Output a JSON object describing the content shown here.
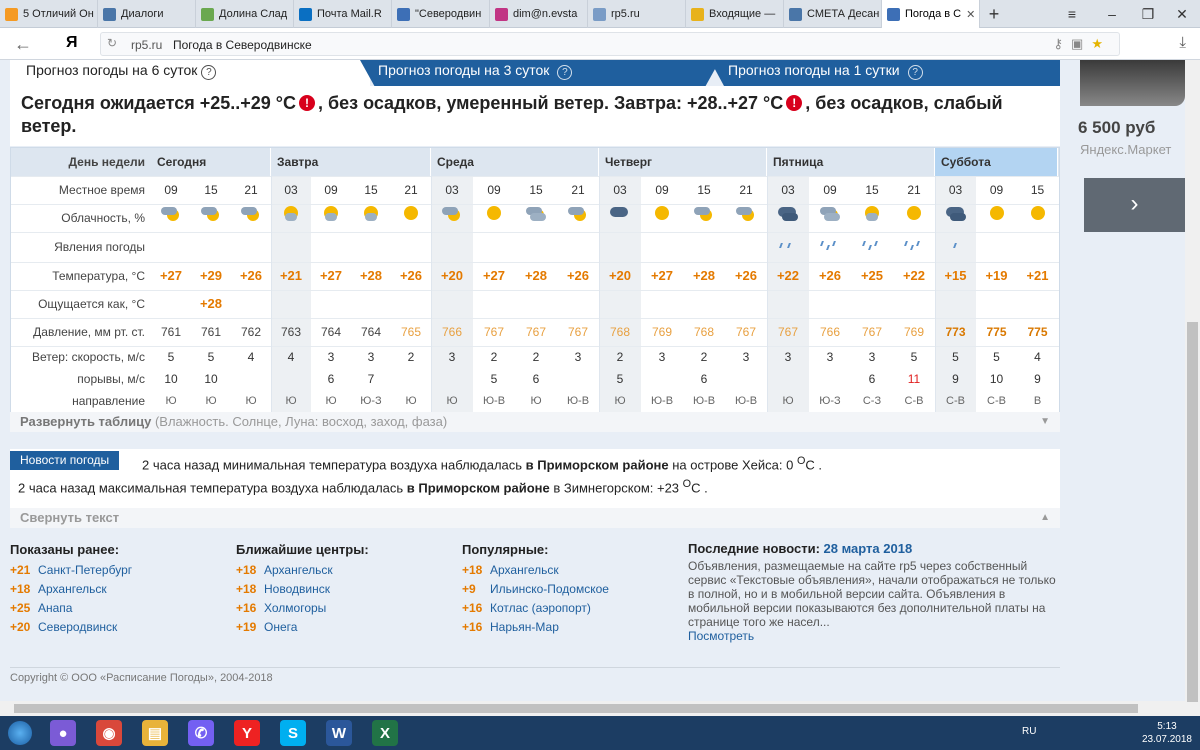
{
  "browser": {
    "tabs": [
      {
        "label": "5 Отличий Он",
        "color": "#f59a23"
      },
      {
        "label": "Диалоги",
        "color": "#4a76a8"
      },
      {
        "label": "Долина Слад",
        "color": "#6aa84f"
      },
      {
        "label": "Почта Mail.R",
        "color": "#0a6fc2"
      },
      {
        "label": "\"Северодвин",
        "color": "#3d6fb6"
      },
      {
        "label": "dim@n.evsta",
        "color": "#c13584"
      },
      {
        "label": "rp5.ru",
        "color": "#7a9cc6"
      },
      {
        "label": "Входящие —",
        "color": "#e8b21b"
      },
      {
        "label": "СМЕТА Десан",
        "color": "#4a76a8"
      },
      {
        "label": "Погода в С",
        "color": "#3d6fb6"
      }
    ],
    "address_domain": "rp5.ru",
    "address_title": "Погода в Северодвинске",
    "yandex_logo": "Я"
  },
  "page": {
    "period_tabs": [
      {
        "label": "Прогноз погоды на 6 суток",
        "help": "?"
      },
      {
        "label": "Прогноз погоды на 3 суток",
        "help": "?"
      },
      {
        "label": "Прогноз погоды на 1 сутки",
        "help": "?"
      }
    ],
    "summary": {
      "part1": "Сегодня ожидается +25..+29 °C",
      "part2": ", без осадков, умеренный ветер. Завтра: +28..+27 °C",
      "part3": ", без осадков, слабый ветер.",
      "warn_icon": "!"
    },
    "table": {
      "labels": {
        "day": "День недели",
        "time": "Местное время",
        "cloud": "Облачность, %",
        "phenom": "Явления погоды",
        "temp": "Температура, °C",
        "feels": "Ощущается как, °C",
        "pressure": "Давление, мм рт. ст.",
        "wind": "Ветер: скорость, м/с",
        "gusts": "порывы, м/с",
        "direction": "направление"
      },
      "days": [
        "Сегодня",
        "Завтра",
        "Среда",
        "Четверг",
        "Пятница",
        "Суббота"
      ],
      "times": [
        "09",
        "15",
        "21",
        "03",
        "09",
        "15",
        "21",
        "03",
        "09",
        "15",
        "21",
        "03",
        "09",
        "15",
        "21",
        "03",
        "09",
        "15",
        "21",
        "03",
        "09",
        "15"
      ],
      "temps": [
        "+27",
        "+29",
        "+26",
        "+21",
        "+27",
        "+28",
        "+26",
        "+20",
        "+27",
        "+28",
        "+26",
        "+20",
        "+27",
        "+28",
        "+26",
        "+22",
        "+26",
        "+25",
        "+22",
        "+15",
        "+19",
        "+21"
      ],
      "feels": [
        "",
        "+28",
        "",
        "",
        "",
        "",
        "",
        "",
        "",
        "",
        "",
        "",
        "",
        "",
        "",
        "",
        "",
        "",
        "",
        "",
        "",
        ""
      ],
      "pressure": [
        "761",
        "761",
        "762",
        "763",
        "764",
        "764",
        "765",
        "766",
        "767",
        "767",
        "767",
        "768",
        "769",
        "768",
        "767",
        "767",
        "766",
        "767",
        "769",
        "773",
        "775",
        "775"
      ],
      "wind": [
        "5",
        "5",
        "4",
        "4",
        "3",
        "3",
        "2",
        "3",
        "2",
        "2",
        "3",
        "2",
        "3",
        "2",
        "3",
        "3",
        "3",
        "3",
        "5",
        "5",
        "5",
        "4"
      ],
      "gusts": [
        "10",
        "10",
        "",
        "",
        "6",
        "7",
        "",
        "",
        "5",
        "6",
        "",
        "5",
        "",
        "6",
        "",
        "",
        "",
        "6",
        "11",
        "9",
        "10",
        "9"
      ],
      "direction": [
        "Ю",
        "Ю",
        "Ю",
        "Ю",
        "Ю",
        "Ю-З",
        "Ю",
        "Ю",
        "Ю-В",
        "Ю",
        "Ю-В",
        "Ю",
        "Ю-В",
        "Ю-В",
        "Ю-В",
        "Ю",
        "Ю-З",
        "С-З",
        "С-В",
        "С-В",
        "С-В",
        "В"
      ]
    },
    "expand_label": "Развернуть таблицу",
    "expand_hint": "(Влажность. Солнце, Луна: восход, заход, фаза)",
    "news": {
      "header": "Новости погоды",
      "line1_pre": "2 часа назад минимальная температура воздуха наблюдалась ",
      "line1_bold": "в Приморском районе",
      "line1_post": " на острове Хейса: 0 ",
      "line1_unit": "C",
      "line1_deg": "O",
      "line2_pre": "2 часа назад максимальная температура воздуха наблюдалась ",
      "line2_bold": "в Приморском районе",
      "line2_post": " в Зимнегорском: +23 ",
      "line2_deg": "O",
      "line2_unit": "C",
      "collapse": "Свернуть текст"
    },
    "shown_before": {
      "title": "Показаны ранее:",
      "items": [
        {
          "temp": "+21",
          "city": "Санкт-Петербург"
        },
        {
          "temp": "+18",
          "city": "Архангельск"
        },
        {
          "temp": "+25",
          "city": "Анапа"
        },
        {
          "temp": "+20",
          "city": "Северодвинск"
        }
      ]
    },
    "nearest": {
      "title": "Ближайшие центры:",
      "items": [
        {
          "temp": "+18",
          "city": "Архангельск"
        },
        {
          "temp": "+18",
          "city": "Новодвинск"
        },
        {
          "temp": "+16",
          "city": "Холмогоры"
        },
        {
          "temp": "+19",
          "city": "Онега"
        }
      ]
    },
    "popular": {
      "title": "Популярные:",
      "items": [
        {
          "temp": "+18",
          "city": "Архангельск"
        },
        {
          "temp": "+9",
          "city": "Ильинско-Подомское"
        },
        {
          "temp": "+16",
          "city": "Котлас (аэропорт)"
        },
        {
          "temp": "+16",
          "city": "Нарьян-Мар"
        }
      ]
    },
    "last_news": {
      "title": "Последние новости:",
      "date": "28 марта 2018",
      "text": "Объявления, размещаемые на сайте rp5 через собственный сервис «Текстовые объявления», начали отображаться не только в полной, но и в мобильной версии сайта. Объявления в мобильной версии показываются без дополнительной платы на странице того же насел...",
      "link": "Посмотреть"
    },
    "copyright": "Copyright © ООО «Расписание Погоды», 2004-2018",
    "ad": {
      "price": "6 500 руб",
      "source": "Яндекс.Маркет",
      "arrow": "›"
    }
  },
  "taskbar": {
    "lang": "RU",
    "time": "5:13",
    "date": "23.07.2018",
    "apps": [
      {
        "name": "Microphone",
        "glyph": "●",
        "color": "#7b5bd6"
      },
      {
        "name": "Chrome",
        "glyph": "◉",
        "color": "#d9483b"
      },
      {
        "name": "Explorer",
        "glyph": "▤",
        "color": "#e8b33a"
      },
      {
        "name": "Viber",
        "glyph": "✆",
        "color": "#7360f2"
      },
      {
        "name": "Yandex",
        "glyph": "Y",
        "color": "#e22"
      },
      {
        "name": "Skype",
        "glyph": "S",
        "color": "#00aff0"
      },
      {
        "name": "Word",
        "glyph": "W",
        "color": "#2b579a"
      },
      {
        "name": "Excel",
        "glyph": "X",
        "color": "#217346"
      }
    ]
  },
  "colors": {
    "brand": "#1f5f9e",
    "temp": "#e47a00",
    "link": "#1f5f9e"
  }
}
